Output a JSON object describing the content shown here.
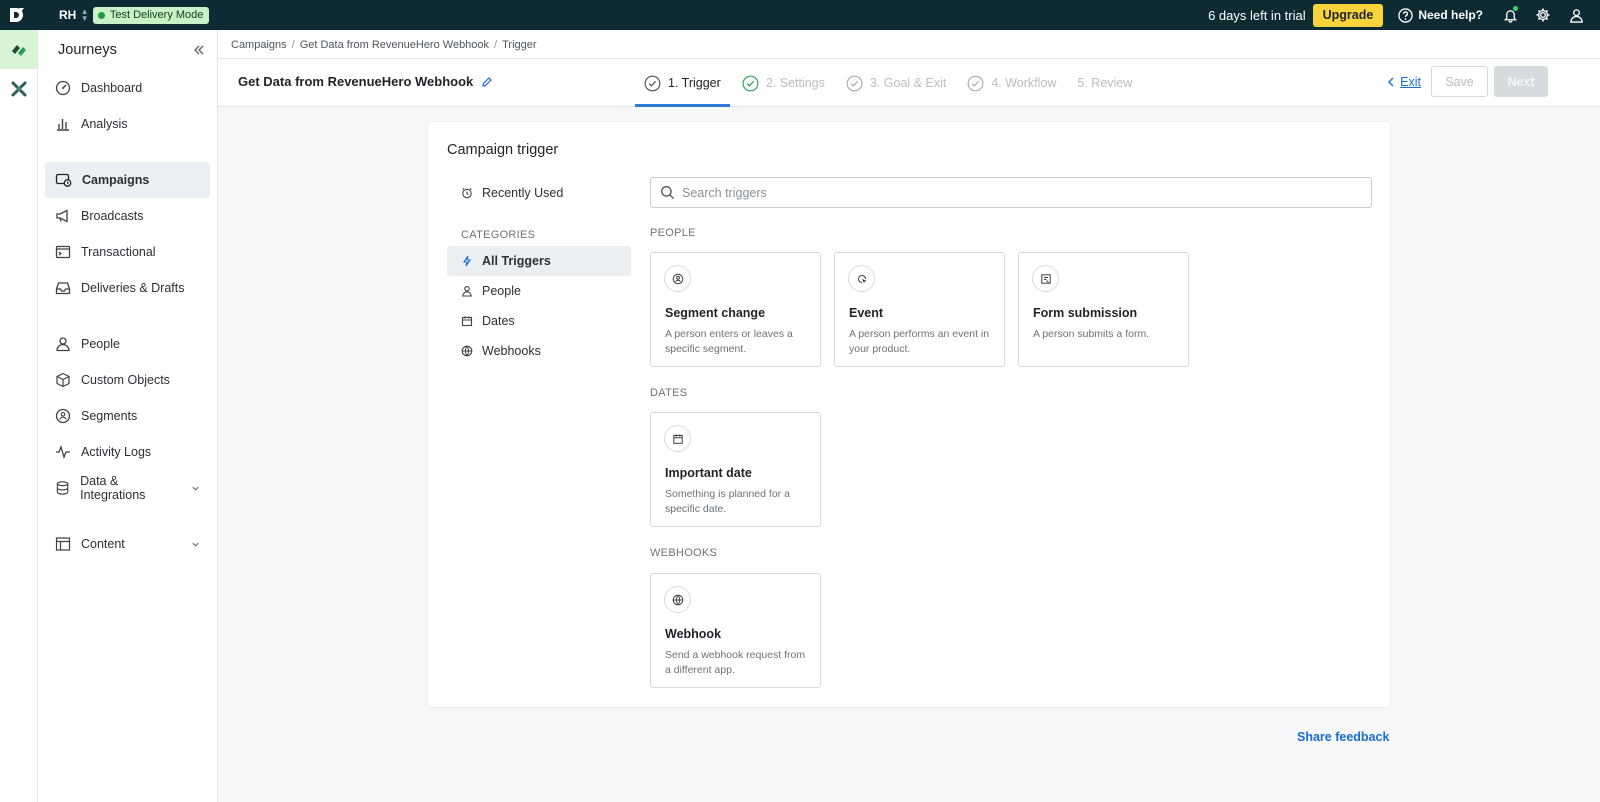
{
  "topbar": {
    "workspace": "RH",
    "mode_badge": "Test Delivery Mode",
    "trial_text": "6 days left in trial",
    "upgrade_label": "Upgrade",
    "help_label": "Need help?"
  },
  "sidebar": {
    "title": "Journeys",
    "items": [
      {
        "label": "Dashboard",
        "icon": "gauge-icon"
      },
      {
        "label": "Analysis",
        "icon": "bar-chart-icon"
      },
      {
        "label": "Campaigns",
        "icon": "campaign-icon",
        "active": true
      },
      {
        "label": "Broadcasts",
        "icon": "megaphone-icon"
      },
      {
        "label": "Transactional",
        "icon": "terminal-icon"
      },
      {
        "label": "Deliveries & Drafts",
        "icon": "inbox-icon"
      },
      {
        "label": "People",
        "icon": "person-icon"
      },
      {
        "label": "Custom Objects",
        "icon": "cube-icon"
      },
      {
        "label": "Segments",
        "icon": "segment-icon"
      },
      {
        "label": "Activity Logs",
        "icon": "pulse-icon"
      },
      {
        "label": "Data & Integrations",
        "icon": "database-icon"
      },
      {
        "label": "Content",
        "icon": "table-icon"
      }
    ]
  },
  "breadcrumb": {
    "items": [
      "Campaigns",
      "Get Data from RevenueHero Webhook",
      "Trigger"
    ],
    "separator": "/"
  },
  "header": {
    "campaign_title": "Get Data from RevenueHero Webhook",
    "steps": [
      {
        "label": "1. Trigger",
        "state": "active"
      },
      {
        "label": "2. Settings",
        "state": "disabled"
      },
      {
        "label": "3. Goal & Exit",
        "state": "disabled"
      },
      {
        "label": "4. Workflow",
        "state": "disabled"
      },
      {
        "label": "5. Review",
        "state": "disabled"
      }
    ],
    "exit_label": "Exit",
    "save_label": "Save",
    "next_label": "Next"
  },
  "trigger": {
    "title": "Campaign trigger",
    "recently_used": "Recently Used",
    "categories_label": "CATEGORIES",
    "categories": [
      "All Triggers",
      "People",
      "Dates",
      "Webhooks"
    ],
    "active_category": "All Triggers",
    "search_placeholder": "Search triggers",
    "search_value": "",
    "sections": [
      {
        "label": "PEOPLE",
        "cards": [
          {
            "name": "Segment change",
            "desc": "A person enters or leaves a specific segment.",
            "icon": "segment-icon"
          },
          {
            "name": "Event",
            "desc": "A person performs an event in your product.",
            "icon": "cursor-click-icon"
          },
          {
            "name": "Form submission",
            "desc": "A person submits a form.",
            "icon": "form-icon"
          }
        ]
      },
      {
        "label": "DATES",
        "cards": [
          {
            "name": "Important date",
            "desc": "Something is planned for a specific date.",
            "icon": "calendar-icon"
          }
        ]
      },
      {
        "label": "WEBHOOKS",
        "cards": [
          {
            "name": "Webhook",
            "desc": "Send a webhook request from a different app.",
            "icon": "globe-icon"
          }
        ]
      }
    ]
  },
  "feedback_label": "Share feedback",
  "colors": {
    "topbar_bg": "#0e2a33",
    "accent": "#1a6cd3",
    "upgrade": "#f6d33b",
    "mode_badge_bg": "#c9f2c9",
    "success_green": "#1e9b3a"
  }
}
